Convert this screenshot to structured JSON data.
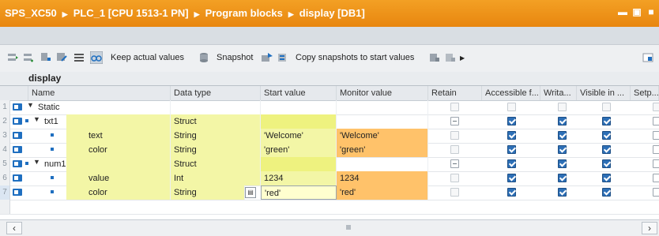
{
  "window": {
    "breadcrumbs": [
      "SPS_XC50",
      "PLC_1 [CPU 1513-1 PN]",
      "Program blocks",
      "display [DB1]"
    ],
    "controls": [
      "minimize-icon",
      "restore-icon",
      "close-icon"
    ]
  },
  "toolbar": {
    "keep_actual_values": "Keep actual values",
    "snapshot": "Snapshot",
    "copy_snapshots": "Copy snapshots to start values"
  },
  "db_title": "display",
  "columns": [
    "Name",
    "Data type",
    "Start value",
    "Monitor value",
    "Retain",
    "Accessible f...",
    "Writa...",
    "Visible in ...",
    "Setp..."
  ],
  "rows": [
    {
      "num": "1",
      "name": "Static",
      "type": "",
      "start": "",
      "monitor": ""
    },
    {
      "num": "2",
      "name": "txt1",
      "type": "Struct",
      "start": "",
      "monitor": ""
    },
    {
      "num": "3",
      "name": "text",
      "type": "String",
      "start": "'Welcome'",
      "monitor": "'Welcome'"
    },
    {
      "num": "4",
      "name": "color",
      "type": "String",
      "start": "'green'",
      "monitor": "'green'"
    },
    {
      "num": "5",
      "name": "num1",
      "type": "Struct",
      "start": "",
      "monitor": ""
    },
    {
      "num": "6",
      "name": "value",
      "type": "Int",
      "start": "1234",
      "monitor": "1234"
    },
    {
      "num": "7",
      "name": "color",
      "type": "String",
      "start": "'red'",
      "monitor": "'red'"
    }
  ],
  "colors": {
    "title_orange": "#e8860f",
    "highlight_yellow": "#f3f6a6",
    "monitor_orange": "#ffc26a",
    "checkbox_blue": "#2d6fb6"
  }
}
